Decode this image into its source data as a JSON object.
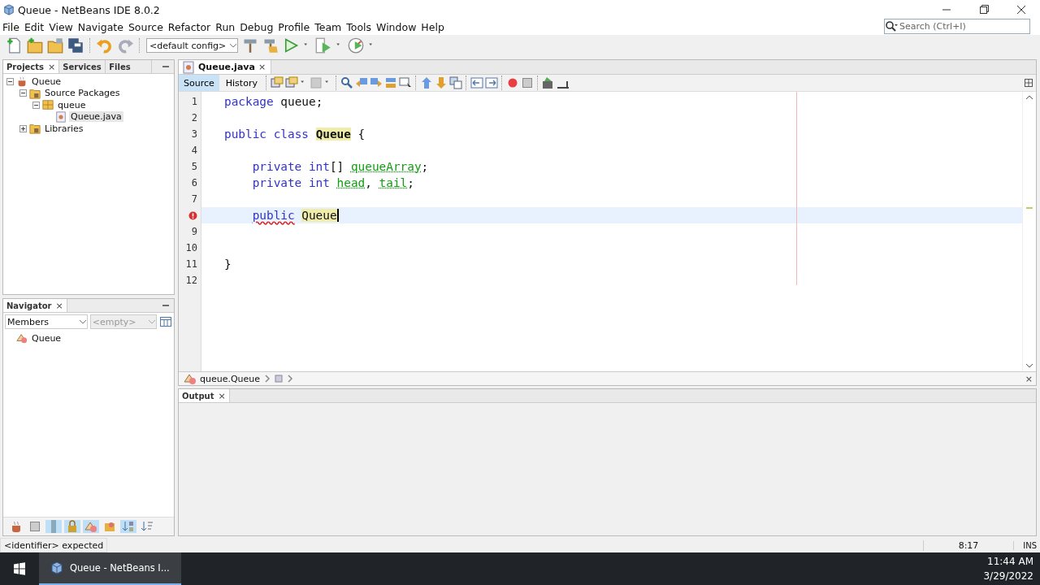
{
  "window": {
    "title": "Queue - NetBeans IDE 8.0.2"
  },
  "menu": [
    "File",
    "Edit",
    "View",
    "Navigate",
    "Source",
    "Refactor",
    "Run",
    "Debug",
    "Profile",
    "Team",
    "Tools",
    "Window",
    "Help"
  ],
  "toolbar": {
    "config": "<default config>"
  },
  "search": {
    "placeholder": "Search (Ctrl+I)"
  },
  "projects_panel": {
    "tabs": [
      {
        "label": "Projects",
        "selected": true,
        "close": "×"
      },
      {
        "label": "Services",
        "selected": false
      },
      {
        "label": "Files",
        "selected": false
      }
    ],
    "tree": [
      {
        "label": "Queue",
        "kind": "project",
        "expanded": true,
        "selected": false,
        "children": [
          {
            "label": "Source Packages",
            "kind": "folder",
            "expanded": true,
            "selected": false,
            "children": [
              {
                "label": "queue",
                "kind": "package",
                "expanded": true,
                "selected": false,
                "children": [
                  {
                    "label": "Queue.java",
                    "kind": "file",
                    "selected": true
                  }
                ]
              }
            ]
          },
          {
            "label": "Libraries",
            "kind": "folder",
            "expanded": false,
            "selected": false
          }
        ]
      }
    ]
  },
  "navigator": {
    "title": "Navigator",
    "close": "×",
    "view": "Members",
    "filter": {
      "placeholder": "<empty>",
      "disabled": true
    },
    "tree": [
      {
        "label": "Queue"
      }
    ],
    "filters": [
      {
        "selected": false
      },
      {
        "selected": false
      },
      {
        "selected": true
      },
      {
        "selected": true
      },
      {
        "selected": true
      },
      {
        "selected": false
      },
      {
        "selected": true
      },
      {
        "selected": false
      }
    ]
  },
  "editor": {
    "tabs": [
      {
        "label": "Queue.java",
        "selected": true,
        "close": "×"
      }
    ],
    "views": [
      {
        "label": "Source",
        "selected": true
      },
      {
        "label": "History",
        "selected": false
      }
    ],
    "lines": [
      {
        "number": "1",
        "indented": false,
        "tokens": [
          {
            "text": "package",
            "kind": "keyword"
          },
          {
            "text": " queue;",
            "kind": "plain"
          }
        ]
      },
      {
        "number": "2"
      },
      {
        "number": "3",
        "indented": false,
        "tokens": [
          {
            "text": "public class",
            "kind": "keyword"
          },
          {
            "text": "Queue",
            "kind": "declaration",
            "space_before": true
          },
          {
            "text": " {",
            "kind": "plain"
          }
        ]
      },
      {
        "number": "4"
      },
      {
        "number": "5",
        "indented": true,
        "tokens": [
          {
            "text": "private int",
            "kind": "keyword"
          },
          {
            "text": "[] ",
            "kind": "plain"
          },
          {
            "text": "queueArray",
            "kind": "field"
          },
          {
            "text": ";",
            "kind": "plain"
          }
        ]
      },
      {
        "number": "6",
        "indented": true,
        "tokens": [
          {
            "text": "private int",
            "kind": "keyword"
          },
          {
            "text": "head",
            "kind": "field",
            "space_before": true
          },
          {
            "text": ", ",
            "kind": "plain"
          },
          {
            "text": "tail",
            "kind": "field"
          },
          {
            "text": ";",
            "kind": "plain"
          }
        ]
      },
      {
        "number": "7"
      },
      {
        "indented": true,
        "tokens": [
          {
            "text": "public",
            "kind": "keyword",
            "error": true
          },
          {
            "text": "Queue",
            "kind": "occurrence",
            "caret": true,
            "space_before": true
          }
        ]
      },
      {
        "number": "9"
      },
      {
        "number": "10"
      },
      {
        "number": "11",
        "indented": false,
        "tokens": [
          {
            "text": "}",
            "kind": "plain"
          }
        ]
      },
      {
        "number": "12"
      }
    ],
    "breadcrumb": [
      "queue.Queue"
    ],
    "close": "×"
  },
  "output": {
    "tabs": [
      {
        "label": "Output",
        "selected": true,
        "close": "×"
      }
    ]
  },
  "status_bar": {
    "message": "<identifier> expected",
    "position": "8:17",
    "mode": "INS"
  },
  "taskbar": {
    "apps": [
      {
        "label": "Queue - NetBeans I...",
        "selected": true
      }
    ],
    "time": "11:44 AM",
    "date": "3/29/2022"
  }
}
